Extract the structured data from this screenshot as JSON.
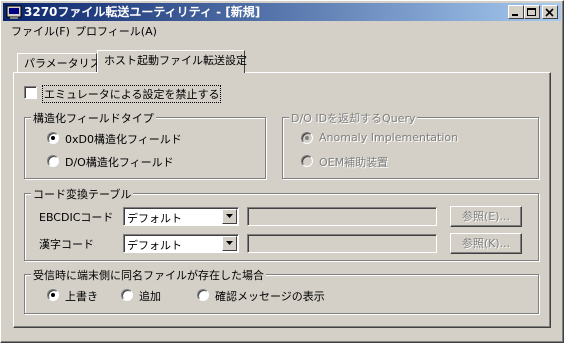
{
  "window": {
    "title": "3270ファイル転送ユーティリティ - [新規]"
  },
  "menu": [
    {
      "label": "ファイル(F)"
    },
    {
      "label": "プロフィール(A)"
    }
  ],
  "tabs": [
    {
      "label": "パラメータリスト",
      "active": false
    },
    {
      "label": "ホスト起動ファイル転送設定",
      "active": true
    }
  ],
  "emulator_checkbox": {
    "label": "エミュレータによる設定を禁止する",
    "checked": false
  },
  "structured_field": {
    "title": "構造化フィールドタイプ",
    "options": [
      {
        "label": "0xD0構造化フィールド",
        "selected": true
      },
      {
        "label": "D/O構造化フィールド",
        "selected": false
      }
    ]
  },
  "do_query": {
    "title": "D/O IDを返却するQuery",
    "options": [
      {
        "label": "Anomaly Implementation",
        "selected": true
      },
      {
        "label": "OEM補助装置",
        "selected": false
      }
    ]
  },
  "code_table": {
    "title": "コード変換テーブル",
    "rows": [
      {
        "label": "EBCDICコード",
        "value": "デフォルト",
        "browse": "参照(E)..."
      },
      {
        "label": "漢字コード",
        "value": "デフォルト",
        "browse": "参照(K)..."
      }
    ]
  },
  "file_exists": {
    "title": "受信時に端末側に同名ファイルが存在した場合",
    "options": [
      {
        "label": "上書き",
        "selected": true
      },
      {
        "label": "追加",
        "selected": false
      },
      {
        "label": "確認メッセージの表示",
        "selected": false
      }
    ]
  },
  "colors": {
    "title_gradient_start": "#0a246a",
    "title_gradient_end": "#a6caf0",
    "face": "#d4d0c8",
    "disabled_text": "#808080"
  }
}
